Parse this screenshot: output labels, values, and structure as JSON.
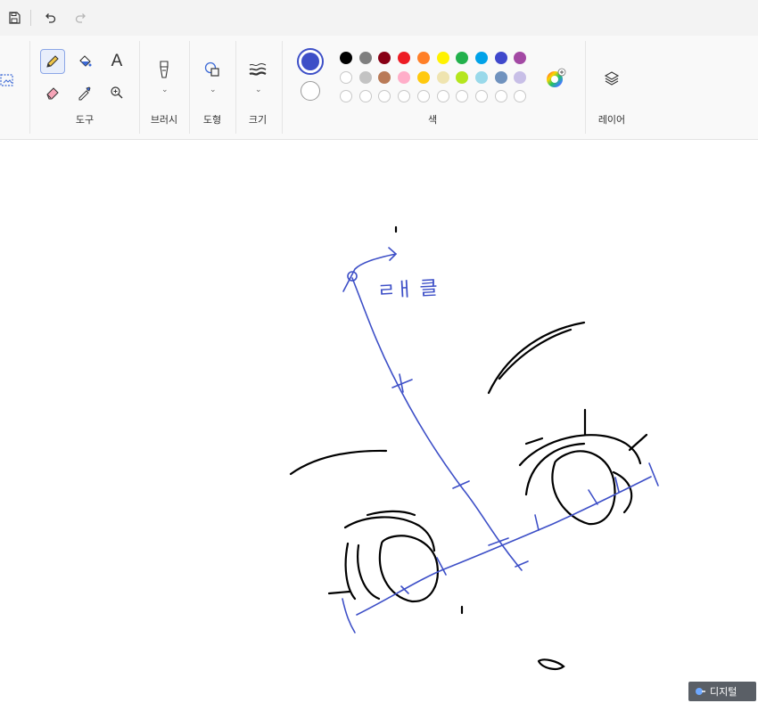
{
  "titlebar": {
    "save_icon": "save-icon",
    "undo_icon": "undo-icon",
    "redo_icon": "redo-icon"
  },
  "ribbon": {
    "groups": {
      "tools": "도구",
      "brush": "브러시",
      "shapes": "도형",
      "size": "크기",
      "color": "색",
      "layers": "레이어"
    },
    "tools": [
      "pencil-icon",
      "fill-bucket-icon",
      "text-icon",
      "eraser-icon",
      "color-picker-icon",
      "magnifier-icon"
    ],
    "text_tool_glyph": "A",
    "primary_color": "#3d4fc7",
    "secondary_color": "#ffffff",
    "palette_row1": [
      "#000000",
      "#7f7f7f",
      "#880015",
      "#ed1c24",
      "#ff7f27",
      "#fff200",
      "#22b14c",
      "#00a2e8",
      "#3f48cc",
      "#a349a4"
    ],
    "palette_row2": [
      "#ffffff",
      "#c3c3c3",
      "#b97a57",
      "#ffaec9",
      "#ffc90e",
      "#efe4b0",
      "#b5e61d",
      "#99d9ea",
      "#7092be",
      "#c8bfe7"
    ],
    "palette_row3_count": 10
  },
  "canvas": {
    "annotation_text": "ㄹㅐ 클",
    "watermark_text": "디지털"
  }
}
